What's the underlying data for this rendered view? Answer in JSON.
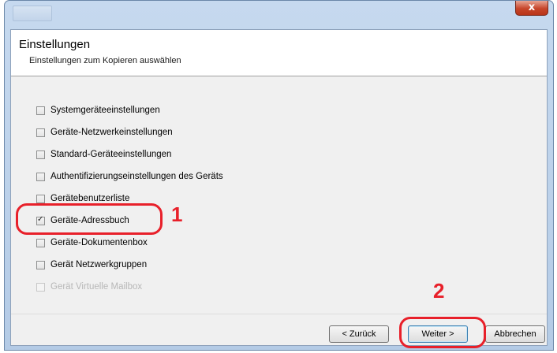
{
  "dialog": {
    "close_glyph": "x",
    "header": {
      "title": "Einstellungen",
      "subtitle": "Einstellungen zum Kopieren auswählen"
    },
    "options": [
      {
        "label": "Systemgeräteeinstellungen",
        "checked": false,
        "enabled": true
      },
      {
        "label": "Geräte-Netzwerkeinstellungen",
        "checked": false,
        "enabled": true
      },
      {
        "label": "Standard-Geräteeinstellungen",
        "checked": false,
        "enabled": true
      },
      {
        "label": "Authentifizierungseinstellungen des Geräts",
        "checked": false,
        "enabled": true
      },
      {
        "label": "Gerätebenutzerliste",
        "checked": false,
        "enabled": true
      },
      {
        "label": "Geräte-Adressbuch",
        "checked": true,
        "enabled": true
      },
      {
        "label": "Geräte-Dokumentenbox",
        "checked": false,
        "enabled": true
      },
      {
        "label": "Gerät Netzwerkgruppen",
        "checked": false,
        "enabled": true
      },
      {
        "label": "Gerät Virtuelle Mailbox",
        "checked": false,
        "enabled": false
      }
    ],
    "buttons": {
      "back": "< Zurück",
      "next": "Weiter >",
      "cancel": "Abbrechen"
    }
  },
  "annotations": {
    "step1": "1",
    "step2": "2",
    "color": "#e8202a"
  }
}
